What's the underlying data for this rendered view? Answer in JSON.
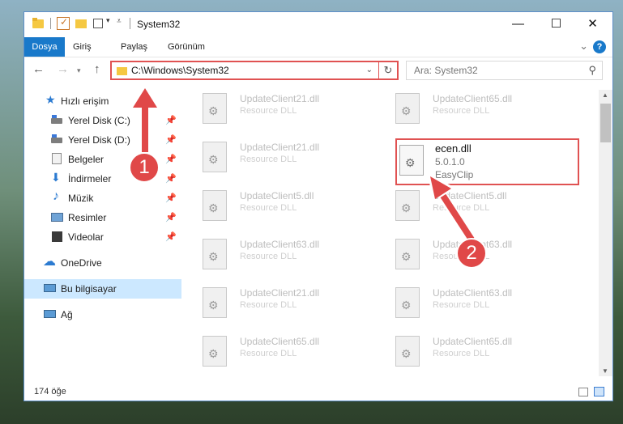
{
  "window": {
    "title": "System32"
  },
  "ribbon": {
    "tabs": [
      "Dosya",
      "Giriş",
      "Paylaş",
      "Görünüm"
    ]
  },
  "address": {
    "path": "C:\\Windows\\System32"
  },
  "search": {
    "placeholder": "Ara: System32"
  },
  "sidebar": {
    "items": [
      {
        "label": "Hızlı erişim",
        "icon": "star-icon",
        "pinned": false
      },
      {
        "label": "Yerel Disk (C:)",
        "icon": "drive-icon",
        "pinned": true
      },
      {
        "label": "Yerel Disk (D:)",
        "icon": "drive-icon",
        "pinned": true
      },
      {
        "label": "Belgeler",
        "icon": "documents-icon",
        "pinned": true
      },
      {
        "label": "İndirmeler",
        "icon": "downloads-icon",
        "pinned": true
      },
      {
        "label": "Müzik",
        "icon": "music-icon",
        "pinned": true
      },
      {
        "label": "Resimler",
        "icon": "pictures-icon",
        "pinned": true
      },
      {
        "label": "Videolar",
        "icon": "videos-icon",
        "pinned": true
      },
      {
        "label": "OneDrive",
        "icon": "onedrive-icon",
        "pinned": false
      },
      {
        "label": "Bu bilgisayar",
        "icon": "computer-icon",
        "pinned": false,
        "selected": true
      },
      {
        "label": "Ağ",
        "icon": "network-icon",
        "pinned": false
      }
    ]
  },
  "files": {
    "left": [
      {
        "name": "UpdateClient21.dll",
        "desc": "Resource DLL"
      },
      {
        "name": "UpdateClient21.dll",
        "desc": "Resource DLL"
      },
      {
        "name": "UpdateClient5.dll",
        "desc": "Resource DLL"
      },
      {
        "name": "UpdateClient63.dll",
        "desc": "Resource DLL"
      },
      {
        "name": "UpdateClient21.dll",
        "desc": "Resource DLL"
      },
      {
        "name": "UpdateClient65.dll",
        "desc": "Resource DLL"
      }
    ],
    "right": [
      {
        "name": "UpdateClient65.dll",
        "desc": "Resource DLL"
      },
      {
        "name": "UpdateClient5.dll",
        "desc": "Resource DLL"
      },
      {
        "name": "UpdateClient63.dll",
        "desc": "Resource DLL"
      },
      {
        "name": "UpdateClient63.dll",
        "desc": "Resource DLL"
      },
      {
        "name": "UpdateClient65.dll",
        "desc": "Resource DLL"
      }
    ],
    "highlighted": {
      "name": "ecen.dll",
      "version": "5.0.1.0",
      "desc": "EasyClip"
    }
  },
  "status": {
    "count": "174 öğe"
  },
  "annotations": {
    "step1": "1",
    "step2": "2",
    "color": "#e04848"
  }
}
